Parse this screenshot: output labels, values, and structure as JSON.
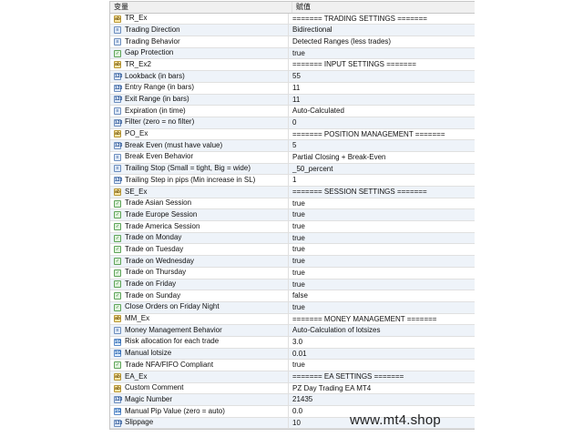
{
  "header": {
    "col_variable": "变量",
    "col_value": "赋值"
  },
  "rows": [
    {
      "icon": "ab",
      "name": "TR_Ex",
      "value": "======= TRADING SETTINGS ======="
    },
    {
      "icon": "enum",
      "name": "Trading Direction",
      "value": "Bidirectional"
    },
    {
      "icon": "enum",
      "name": "Trading Behavior",
      "value": "Detected Ranges (less trades)"
    },
    {
      "icon": "bool",
      "name": "Gap Protection",
      "value": "true"
    },
    {
      "icon": "ab",
      "name": "TR_Ex2",
      "value": "======= INPUT SETTINGS ======="
    },
    {
      "icon": "num",
      "name": "Lookback (in bars)",
      "value": "55"
    },
    {
      "icon": "num",
      "name": "Entry Range (in bars)",
      "value": "11"
    },
    {
      "icon": "num",
      "name": "Exit Range (in bars)",
      "value": "11"
    },
    {
      "icon": "enum",
      "name": "Expiration (in time)",
      "value": "Auto-Calculated"
    },
    {
      "icon": "num",
      "name": "Filter (zero = no filter)",
      "value": "0"
    },
    {
      "icon": "ab",
      "name": "PO_Ex",
      "value": "======= POSITION MANAGEMENT ======="
    },
    {
      "icon": "num",
      "name": "Break Even (must have value)",
      "value": "5"
    },
    {
      "icon": "enum",
      "name": "Break Even Behavior",
      "value": "Partial Closing + Break-Even"
    },
    {
      "icon": "enum",
      "name": "Trailing Stop (Small = tight, Big = wide)",
      "value": "_50_percent"
    },
    {
      "icon": "num",
      "name": "Trailing Step in pips (Min increase in SL)",
      "value": "1"
    },
    {
      "icon": "ab",
      "name": "SE_Ex",
      "value": "======= SESSION SETTINGS ======="
    },
    {
      "icon": "bool",
      "name": "Trade Asian Session",
      "value": "true"
    },
    {
      "icon": "bool",
      "name": "Trade Europe Session",
      "value": "true"
    },
    {
      "icon": "bool",
      "name": "Trade America Session",
      "value": "true"
    },
    {
      "icon": "bool",
      "name": "Trade on Monday",
      "value": "true"
    },
    {
      "icon": "bool",
      "name": "Trade on Tuesday",
      "value": "true"
    },
    {
      "icon": "bool",
      "name": "Trade on Wednesday",
      "value": "true"
    },
    {
      "icon": "bool",
      "name": "Trade on Thursday",
      "value": "true"
    },
    {
      "icon": "bool",
      "name": "Trade on Friday",
      "value": "true"
    },
    {
      "icon": "bool",
      "name": "Trade on Sunday",
      "value": "false"
    },
    {
      "icon": "bool",
      "name": "Close Orders on Friday Night",
      "value": "true"
    },
    {
      "icon": "ab",
      "name": "MM_Ex",
      "value": "======= MONEY MANAGEMENT ======="
    },
    {
      "icon": "enum",
      "name": "Money Management Behavior",
      "value": "Auto-Calculation of lotsizes"
    },
    {
      "icon": "dec",
      "name": "Risk allocation for each trade",
      "value": "3.0"
    },
    {
      "icon": "dec",
      "name": "Manual lotsize",
      "value": "0.01"
    },
    {
      "icon": "bool",
      "name": "Trade NFA/FIFO Compliant",
      "value": "true"
    },
    {
      "icon": "ab",
      "name": "EA_Ex",
      "value": "======= EA SETTINGS ======="
    },
    {
      "icon": "ab",
      "name": "Custom Comment",
      "value": "PZ Day Trading EA MT4"
    },
    {
      "icon": "num",
      "name": "Magic Number",
      "value": "21435"
    },
    {
      "icon": "dec",
      "name": "Manual Pip Value (zero = auto)",
      "value": "0.0"
    },
    {
      "icon": "num",
      "name": "Slippage",
      "value": "10"
    }
  ],
  "watermark": "www.mt4.shop"
}
